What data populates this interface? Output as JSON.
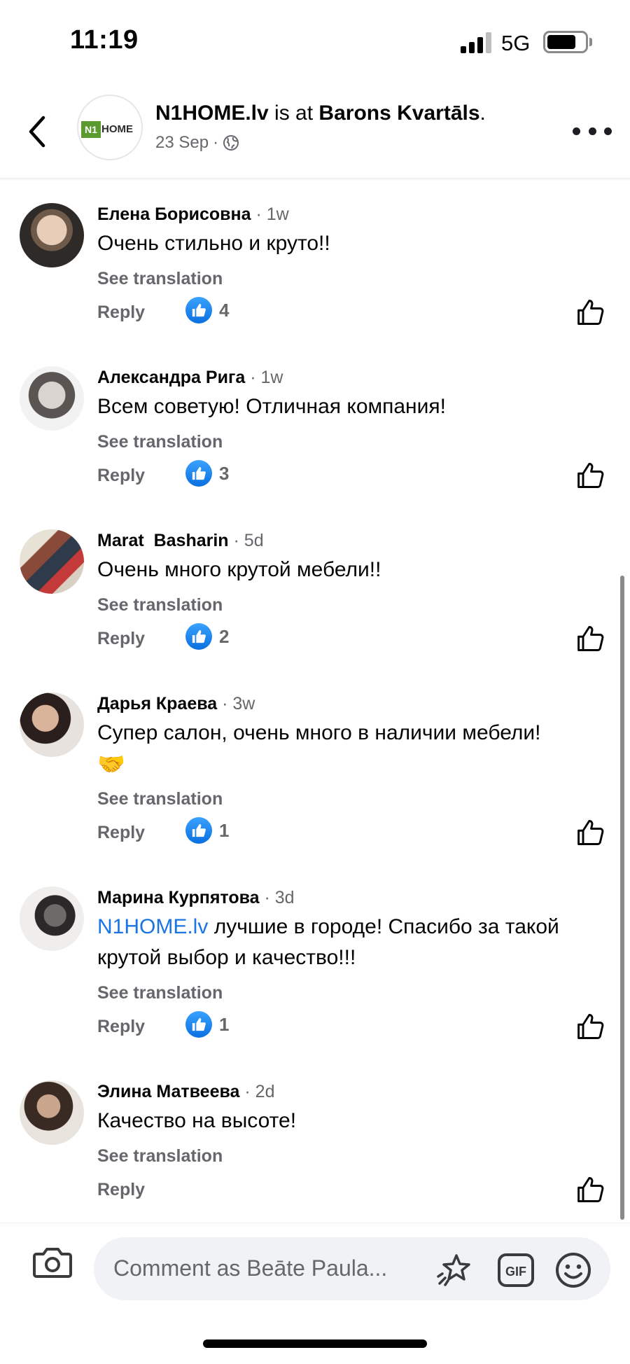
{
  "status_bar": {
    "time": "11:19",
    "network": "5G"
  },
  "header": {
    "page_name": "N1HOME.lv",
    "connector": " is at ",
    "place": "Barons Kvartāls",
    "period": ".",
    "date": "23 Sep",
    "separator": "·",
    "logo_mark": "N1",
    "logo_text": "HOME",
    "icons": {
      "back": "chevron-left-icon",
      "privacy": "globe-icon",
      "more": "more-icon"
    }
  },
  "comments": [
    {
      "author": "Елена Борисовна",
      "time": "· 1w",
      "text": "Очень стильно и круто!!",
      "see_translation": "See translation",
      "reply": "Reply",
      "likes": "4"
    },
    {
      "author": "Александра Рига",
      "time": "· 1w",
      "text": "Всем советую! Отличная компания!",
      "see_translation": "See translation",
      "reply": "Reply",
      "likes": "3"
    },
    {
      "author": "Marat  Basharin",
      "time": "· 5d",
      "text": "Очень много крутой мебели!!",
      "see_translation": "See translation",
      "reply": "Reply",
      "likes": "2"
    },
    {
      "author": "Дарья Краева",
      "time": "· 3w",
      "text": "Супер салон, очень много в наличии мебели!",
      "emoji": "🤝",
      "see_translation": "See translation",
      "reply": "Reply",
      "likes": "1"
    },
    {
      "author": "Марина Курпятова",
      "time": "· 3d",
      "mention": "N1HOME.lv",
      "text": " лучшие в городе! Спасибо за такой крутой выбор и качество!!!",
      "see_translation": "See translation",
      "reply": "Reply",
      "likes": "1"
    },
    {
      "author": "Элина Матвеева",
      "time": "· 2d",
      "text": "Качество на высоте!",
      "see_translation": "See translation",
      "reply": "Reply",
      "likes": ""
    }
  ],
  "composer": {
    "placeholder": "Comment as Beāte Paula...",
    "icons": [
      "camera-icon",
      "sticker-icon",
      "gif-icon",
      "emoji-icon"
    ]
  },
  "colors": {
    "accent": "#1b74e4",
    "secondary_text": "#65676b",
    "like_badge": "#1877f2",
    "logo_green": "#5a9a2f"
  }
}
